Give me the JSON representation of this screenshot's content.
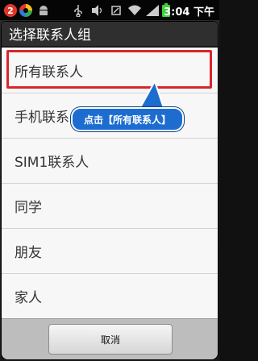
{
  "status_bar": {
    "notification_count": "2",
    "time": "3:04 下午",
    "icons": [
      "colorwheel-icon",
      "android-icon",
      "usb-icon",
      "vibrate-icon",
      "usb-debug-icon",
      "wifi-icon",
      "signal-icon",
      "battery-icon"
    ]
  },
  "dialog": {
    "title": "选择联系人组",
    "items": [
      {
        "label": "所有联系人"
      },
      {
        "label": "手机联系人"
      },
      {
        "label": "SIM1联系人"
      },
      {
        "label": "同学"
      },
      {
        "label": "朋友"
      },
      {
        "label": "家人"
      }
    ],
    "cancel_label": "取消"
  },
  "annotation": {
    "callout_text": "点击【所有联系人】",
    "highlight_color": "#d8262c",
    "callout_color": "#1d6dd0"
  }
}
